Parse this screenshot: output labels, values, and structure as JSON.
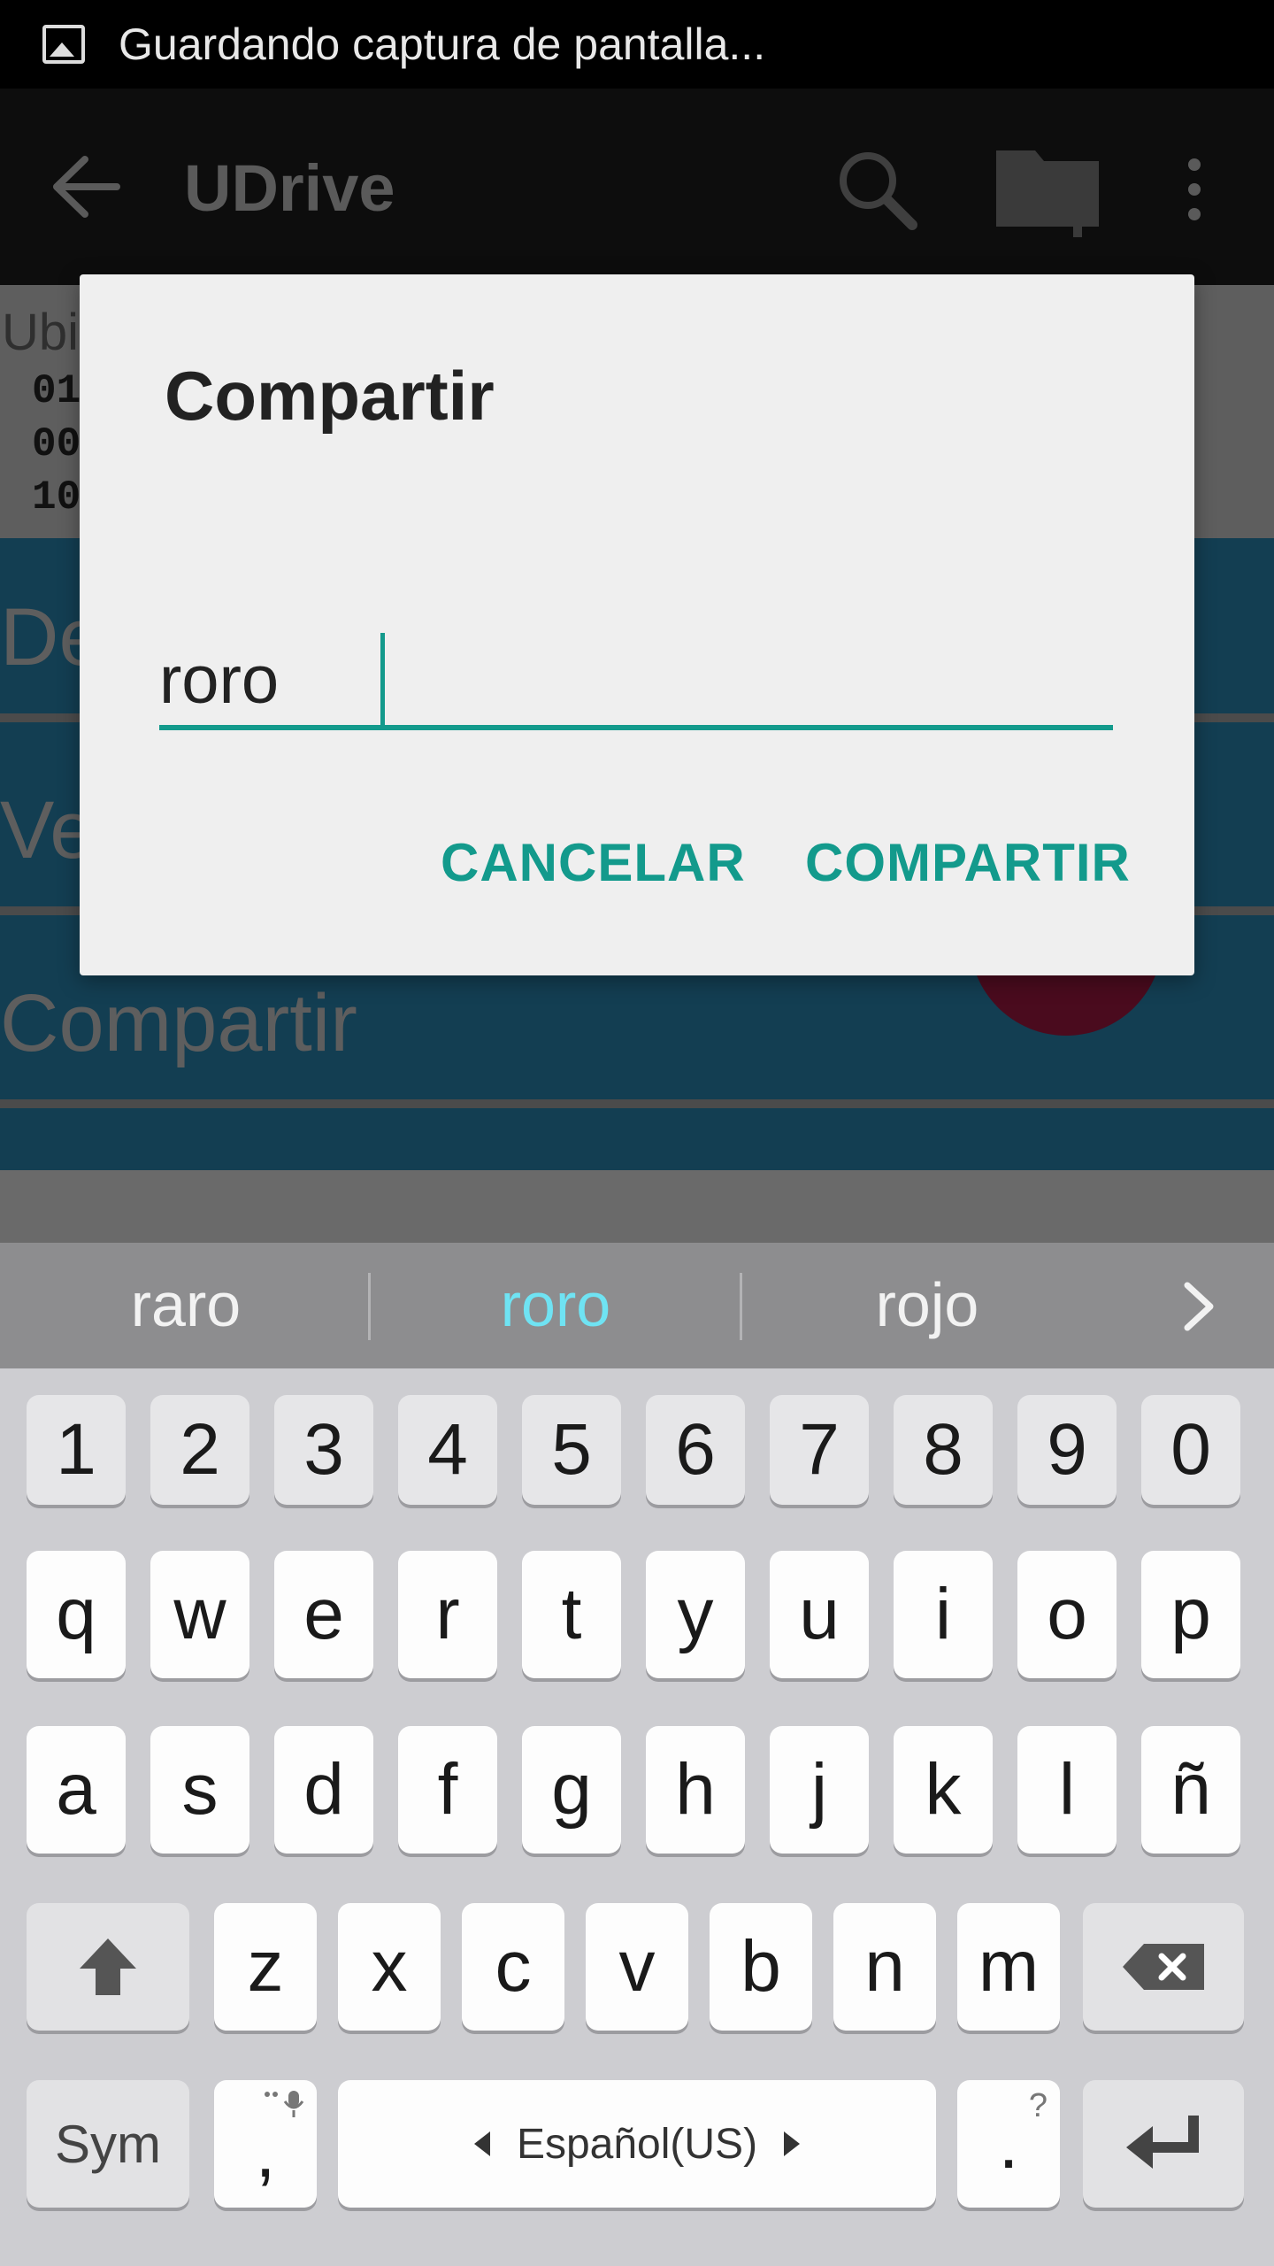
{
  "status_bar": {
    "notification_text": "Guardando captura de pantalla..."
  },
  "app_bar": {
    "title": "UDrive"
  },
  "background": {
    "info_title": "Ubi",
    "info_lines": [
      "01",
      "00",
      "10"
    ],
    "options": [
      "De",
      "Ve",
      "Compartir"
    ]
  },
  "dialog": {
    "title": "Compartir",
    "input_value": "roro",
    "cancel_label": "CANCELAR",
    "share_label": "COMPARTIR"
  },
  "keyboard": {
    "suggestions": [
      "raro",
      "roro",
      "rojo"
    ],
    "number_row": [
      "1",
      "2",
      "3",
      "4",
      "5",
      "6",
      "7",
      "8",
      "9",
      "0"
    ],
    "row_q": [
      "q",
      "w",
      "e",
      "r",
      "t",
      "y",
      "u",
      "i",
      "o",
      "p"
    ],
    "row_a": [
      "a",
      "s",
      "d",
      "f",
      "g",
      "h",
      "j",
      "k",
      "l",
      "ñ"
    ],
    "row_z": [
      "z",
      "x",
      "c",
      "v",
      "b",
      "n",
      "m"
    ],
    "sym_label": "Sym",
    "comma_label": ",",
    "space_label": "Español(US)",
    "period_label": ".",
    "period_hint": "?",
    "accent_color": "#139a8c",
    "highlight_suggestion_color": "#6fe3f3"
  }
}
